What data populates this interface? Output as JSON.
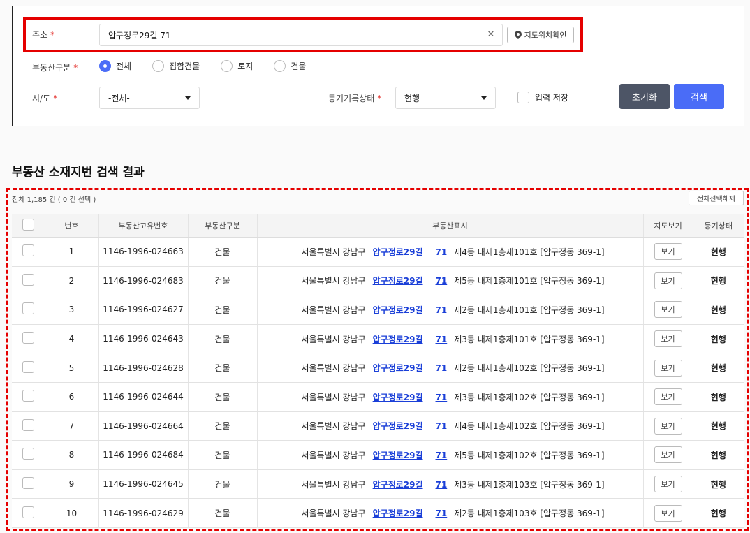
{
  "form": {
    "address": {
      "label": "주소",
      "required": "*",
      "value": "압구정로29길 71",
      "clear_icon": "close-icon",
      "map_button": "지도위치확인",
      "map_icon": "map-pin-icon"
    },
    "property_type": {
      "label": "부동산구분",
      "required": "*",
      "options": [
        "전체",
        "집합건물",
        "토지",
        "건물"
      ],
      "selected": "전체"
    },
    "sido": {
      "label": "시/도",
      "required": "*",
      "value": "-전체-"
    },
    "registry_status": {
      "label": "등기기록상태",
      "required": "*",
      "value": "현행"
    },
    "save_input": {
      "label": "입력 저장",
      "checked": false
    },
    "reset_button": "초기화",
    "search_button": "검색"
  },
  "results": {
    "title": "부동산 소재지번 검색 결과",
    "summary": "전체 1,185 건 ( 0 건 선택 )",
    "clear_selection_button": "전체선택해제",
    "columns": [
      "번호",
      "부동산고유번호",
      "부동산구분",
      "부동산표시",
      "지도보기",
      "등기상태"
    ],
    "view_label": "보기",
    "rows": [
      {
        "no": "1",
        "id": "1146-1996-024663",
        "type": "건물",
        "prefix": "서울특별시 강남구",
        "road": "압구정로29길",
        "num": "71",
        "rest": "제4동 내제1층제101호 [압구정동 369-1]",
        "status": "현행"
      },
      {
        "no": "2",
        "id": "1146-1996-024683",
        "type": "건물",
        "prefix": "서울특별시 강남구",
        "road": "압구정로29길",
        "num": "71",
        "rest": "제5동 내제1층제101호 [압구정동 369-1]",
        "status": "현행"
      },
      {
        "no": "3",
        "id": "1146-1996-024627",
        "type": "건물",
        "prefix": "서울특별시 강남구",
        "road": "압구정로29길",
        "num": "71",
        "rest": "제2동 내제1층제101호 [압구정동 369-1]",
        "status": "현행"
      },
      {
        "no": "4",
        "id": "1146-1996-024643",
        "type": "건물",
        "prefix": "서울특별시 강남구",
        "road": "압구정로29길",
        "num": "71",
        "rest": "제3동 내제1층제101호 [압구정동 369-1]",
        "status": "현행"
      },
      {
        "no": "5",
        "id": "1146-1996-024628",
        "type": "건물",
        "prefix": "서울특별시 강남구",
        "road": "압구정로29길",
        "num": "71",
        "rest": "제2동 내제1층제102호 [압구정동 369-1]",
        "status": "현행"
      },
      {
        "no": "6",
        "id": "1146-1996-024644",
        "type": "건물",
        "prefix": "서울특별시 강남구",
        "road": "압구정로29길",
        "num": "71",
        "rest": "제3동 내제1층제102호 [압구정동 369-1]",
        "status": "현행"
      },
      {
        "no": "7",
        "id": "1146-1996-024664",
        "type": "건물",
        "prefix": "서울특별시 강남구",
        "road": "압구정로29길",
        "num": "71",
        "rest": "제4동 내제1층제102호 [압구정동 369-1]",
        "status": "현행"
      },
      {
        "no": "8",
        "id": "1146-1996-024684",
        "type": "건물",
        "prefix": "서울특별시 강남구",
        "road": "압구정로29길",
        "num": "71",
        "rest": "제5동 내제1층제102호 [압구정동 369-1]",
        "status": "현행"
      },
      {
        "no": "9",
        "id": "1146-1996-024645",
        "type": "건물",
        "prefix": "서울특별시 강남구",
        "road": "압구정로29길",
        "num": "71",
        "rest": "제3동 내제1층제103호 [압구정동 369-1]",
        "status": "현행"
      },
      {
        "no": "10",
        "id": "1146-1996-024629",
        "type": "건물",
        "prefix": "서울특별시 강남구",
        "road": "압구정로29길",
        "num": "71",
        "rest": "제2동 내제1층제103호 [압구정동 369-1]",
        "status": "현행"
      }
    ]
  },
  "colors": {
    "accent": "#4a6cf7",
    "reset": "#4d5566",
    "highlight": "#e50000",
    "link": "#1a3fd8",
    "status": "#1e3a8a"
  }
}
